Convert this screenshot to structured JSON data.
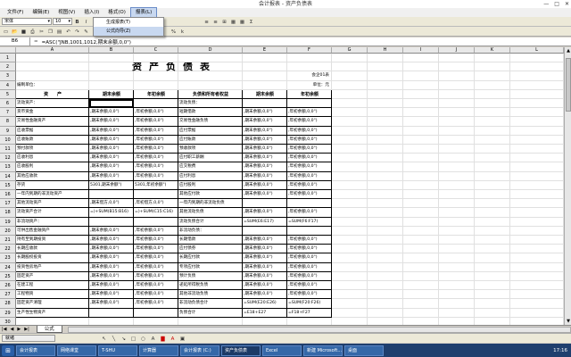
{
  "window": {
    "title": "会计报表 - 资产负债表"
  },
  "menu": [
    "文件(F)",
    "编辑(E)",
    "视图(V)",
    "插入(I)",
    "格式(O)",
    "报表(L)"
  ],
  "toolbar": {
    "font": "宋体",
    "size": "10"
  },
  "dropdown": [
    "生成报表(T)",
    "公式向导(Z)"
  ],
  "formula_bar": {
    "cell": "B6",
    "fx": "=",
    "formula": "=ASC(\"JNB,1001,1012,期末余额,0,0\")"
  },
  "columns": [
    "A",
    "B",
    "C",
    "D",
    "E",
    "F",
    "G",
    "H",
    "I",
    "J",
    "K",
    "L"
  ],
  "sheet": {
    "title": "资产负债表",
    "unit_label": "会企01表",
    "org_label": "编制单位：",
    "currency": "单位：元",
    "headers": [
      "资　　产",
      "期末余额",
      "年初余额",
      "负债和所有者权益",
      "期末余额",
      "年初余额"
    ],
    "rows": [
      {
        "n": "5",
        "a": "流动资产：",
        "b": "",
        "c": "",
        "d": "流动负债：",
        "e": "",
        "f": ""
      },
      {
        "n": "6",
        "a": "货币资金",
        "b": ",期末余额,0,0\")",
        "c": ",年初余额,0,0\")",
        "d": "短期借款",
        "e": ",期末余额,0,0\")",
        "f": ",年初余额,0,0\")"
      },
      {
        "n": "7",
        "a": "交易性金融资产",
        "b": ",期末余额,0,0\")",
        "c": ",年初余额,0,0\")",
        "d": "交易性金融负债",
        "e": ",期末余额,0,0\")",
        "f": ",年初余额,0,0\")"
      },
      {
        "n": "8",
        "a": "应收票据",
        "b": ",期末余额,0,0\")",
        "c": ",年初余额,0,0\")",
        "d": "应付票据",
        "e": ",期末余额,0,0\")",
        "f": ",年初余额,0,0\")"
      },
      {
        "n": "9",
        "a": "应收账款",
        "b": ",期末余额,0,0\")",
        "c": ",年初余额,0,0\")",
        "d": "应付账款",
        "e": ",期末余额,0,0\")",
        "f": ",年初余额,0,0\")"
      },
      {
        "n": "10",
        "a": "预付款项",
        "b": ",期末余额,0,0\")",
        "c": ",年初余额,0,0\")",
        "d": "预收款项",
        "e": ",期末余额,0,0\")",
        "f": ",年初余额,0,0\")"
      },
      {
        "n": "11",
        "a": "应收利息",
        "b": ",期末余额,0,0\")",
        "c": ",年初余额,0,0\")",
        "d": "应付职工薪酬",
        "e": ",期末余额,0,0\")",
        "f": ",年初余额,0,0\")"
      },
      {
        "n": "12",
        "a": "应收股利",
        "b": ",期末余额,0,0\")",
        "c": ",年初余额,0,0\")",
        "d": "应交税费",
        "e": ",期末余额,0,0\")",
        "f": ",年初余额,0,0\")"
      },
      {
        "n": "13",
        "a": "其他应收款",
        "b": ",期末余额,0,0\")",
        "c": ",年初余额,0,0\")",
        "d": "应付利息",
        "e": ",期末余额,0,0\")",
        "f": ",年初余额,0,0\")"
      },
      {
        "n": "14",
        "a": "存货",
        "b": "5301,期末余额\")",
        "c": "5301,年初余额\")",
        "d": "应付股利",
        "e": ",期末余额,0,0\")",
        "f": ",年初余额,0,0\")"
      },
      {
        "n": "15",
        "a": "一年内到期的非流动资产",
        "b": "",
        "c": "",
        "d": "其他应付款",
        "e": ",期末余额,0,0\")",
        "f": ",年初余额,0,0\")"
      },
      {
        "n": "16",
        "a": "其他流动资产",
        "b": ",期末借方,0,0\")",
        "c": ",年初借方,0,0\")",
        "d": "一年内到期的非流动负债",
        "e": "",
        "f": ""
      },
      {
        "n": "17",
        "a": "流动资产合计",
        "b": "=)+SUM(B15:B16)",
        "c": "=)+SUM(C15:C16)",
        "d": "其他流动负债",
        "e": ",期末余额,0,0\")",
        "f": ",年初余额,0,0\")"
      },
      {
        "n": "18",
        "a": "非流动资产：",
        "b": "",
        "c": "",
        "d": "流动负债合计",
        "e": "=SUM(E6:E17)",
        "f": "=SUM(F6:F17)"
      },
      {
        "n": "19",
        "a": "可供出售金融资产",
        "b": ",期末余额,0,0\")",
        "c": ",年初余额,0,0\")",
        "d": "非流动负债：",
        "e": "",
        "f": ""
      },
      {
        "n": "20",
        "a": "持有至到期投资",
        "b": ",期末余额,0,0\")",
        "c": ",年初余额,0,0\")",
        "d": "长期借款",
        "e": ",期末余额,0,0\")",
        "f": ",年初余额,0,0\")"
      },
      {
        "n": "21",
        "a": "长期应收款",
        "b": ",期末余额,0,0\")",
        "c": ",年初余额,0,0\")",
        "d": "应付债券",
        "e": ",期末余额,0,0\")",
        "f": ",年初余额,0,0\")"
      },
      {
        "n": "22",
        "a": "长期股权投资",
        "b": ",期末余额,0,0\")",
        "c": ",年初余额,0,0\")",
        "d": "长期应付款",
        "e": ",期末余额,0,0\")",
        "f": ",年初余额,0,0\")"
      },
      {
        "n": "23",
        "a": "投资性房地产",
        "b": ",期末余额,0,0\")",
        "c": ",年初余额,0,0\")",
        "d": "专项应付款",
        "e": ",期末余额,0,0\")",
        "f": ",年初余额,0,0\")"
      },
      {
        "n": "24",
        "a": "固定资产",
        "b": ",期末余额,0,0\")",
        "c": ",年初余额,0,0\")",
        "d": "预计负债",
        "e": ",期末余额,0,0\")",
        "f": ",年初余额,0,0\")"
      },
      {
        "n": "25",
        "a": "在建工程",
        "b": ",期末余额,0,0\")",
        "c": ",年初余额,0,0\")",
        "d": "递延所得税负债",
        "e": ",期末余额,0,0\")",
        "f": ",年初余额,0,0\")"
      },
      {
        "n": "26",
        "a": "工程物资",
        "b": ",期末余额,0,0\")",
        "c": ",年初余额,0,0\")",
        "d": "其他非流动负债",
        "e": ",期末余额,0,0\")",
        "f": ",年初余额,0,0\")"
      },
      {
        "n": "27",
        "a": "固定资产清理",
        "b": ",期末余额,0,0\")",
        "c": ",年初余额,0,0\")",
        "d": "非流动负债合计",
        "e": "=SUM(E20:E26)",
        "f": "=SUM(F20:F26)"
      },
      {
        "n": "28",
        "a": "生产性生物资产",
        "b": "",
        "c": "",
        "d": "负债合计",
        "e": "=E18+E27",
        "f": "=F18+F27"
      }
    ]
  },
  "sheet_tab": "公式",
  "statusbar": [
    "就绪"
  ],
  "taskbar": [
    "会计报表",
    "网络课堂",
    "T-SHU",
    "计算器",
    "会计报表 (C:)",
    "资产负债表",
    "Excel",
    "新建 Microsoft...",
    "桌面"
  ],
  "clock": "17:16"
}
